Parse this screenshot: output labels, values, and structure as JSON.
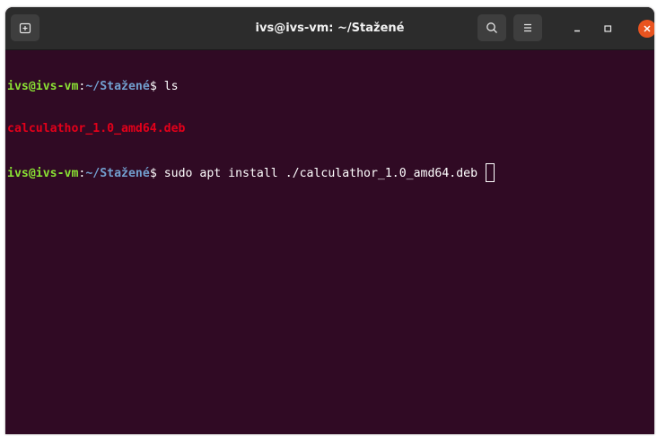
{
  "window": {
    "title": "ivs@ivs-vm: ~/Stažené"
  },
  "header": {
    "new_tab_icon": "new-tab-icon",
    "search_icon": "search-icon",
    "menu_icon": "hamburger-menu-icon",
    "minimize_icon": "minimize-icon",
    "maximize_icon": "maximize-icon",
    "close_icon": "close-icon"
  },
  "terminal": {
    "lines": [
      {
        "user_host": "ivs@ivs-vm",
        "colon": ":",
        "path": "~/Stažené",
        "dollar": "$ ",
        "command": "ls"
      },
      {
        "output": "calculathor_1.0_amd64.deb"
      },
      {
        "user_host": "ivs@ivs-vm",
        "colon": ":",
        "path": "~/Stažené",
        "dollar": "$ ",
        "command": "sudo apt install ./calculathor_1.0_amd64.deb "
      }
    ]
  },
  "colors": {
    "terminal_background": "#300a24",
    "prompt_user": "#8ae234",
    "prompt_path": "#729fcf",
    "deb_file": "#e2001a",
    "close_button": "#e95420",
    "titlebar": "#2c2c2c"
  }
}
